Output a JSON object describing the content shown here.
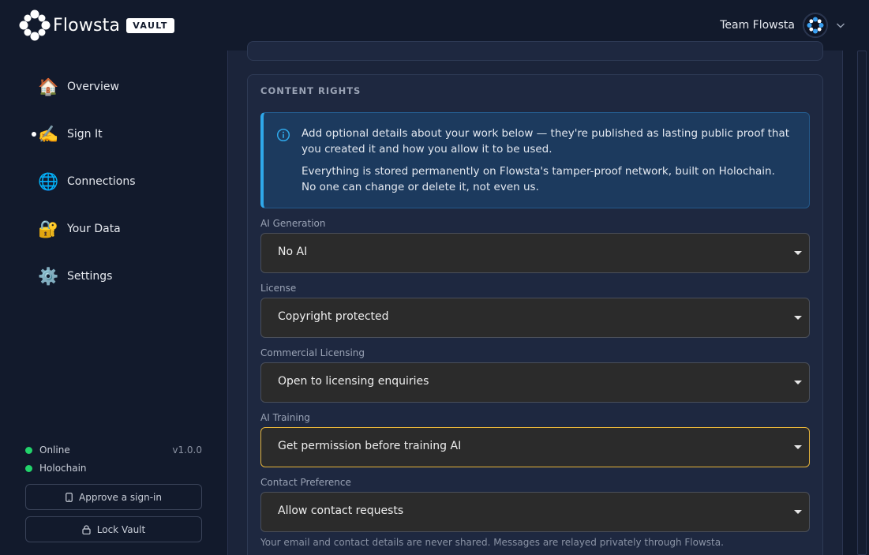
{
  "header": {
    "brand": "Flowsta",
    "badge": "VAULT",
    "team_name": "Team Flowsta"
  },
  "sidebar": {
    "items": [
      {
        "label": "Overview",
        "icon": "house-icon",
        "glyph": "🏠",
        "active": false
      },
      {
        "label": "Sign It",
        "icon": "writing-hand-icon",
        "glyph": "✍️",
        "active": true
      },
      {
        "label": "Connections",
        "icon": "globe-icon",
        "glyph": "🌐",
        "active": false
      },
      {
        "label": "Your Data",
        "icon": "locked-with-key-icon",
        "glyph": "🔐",
        "active": false
      },
      {
        "label": "Settings",
        "icon": "gear-icon",
        "glyph": "⚙️",
        "active": false
      }
    ],
    "status": [
      {
        "label": "Online",
        "color": "#22d36b"
      },
      {
        "label": "Holochain",
        "color": "#22d36b"
      }
    ],
    "version": "v1.0.0",
    "approve_label": "Approve a sign-in",
    "lock_label": "Lock Vault"
  },
  "content_rights": {
    "title": "CONTENT RIGHTS",
    "info_p1": "Add optional details about your work below — they're published as lasting public proof that you created it and how you allow it to be used.",
    "info_p2": "Everything is stored permanently on Flowsta's tamper-proof network, built on Holochain. No one can change or delete it, not even us.",
    "fields": [
      {
        "label": "AI Generation",
        "value": "No AI"
      },
      {
        "label": "License",
        "value": "Copyright protected"
      },
      {
        "label": "Commercial Licensing",
        "value": "Open to licensing enquiries"
      },
      {
        "label": "AI Training",
        "value": "Get permission before training AI",
        "focused": true
      },
      {
        "label": "Contact Preference",
        "value": "Allow contact requests"
      }
    ],
    "note": "Your email and contact details are never shared. Messages are relayed privately through Flowsta."
  },
  "colors": {
    "background": "#121a2c",
    "accent_info": "#2fa8ea",
    "focus_border": "#e6b43a",
    "status_online": "#22d36b"
  }
}
